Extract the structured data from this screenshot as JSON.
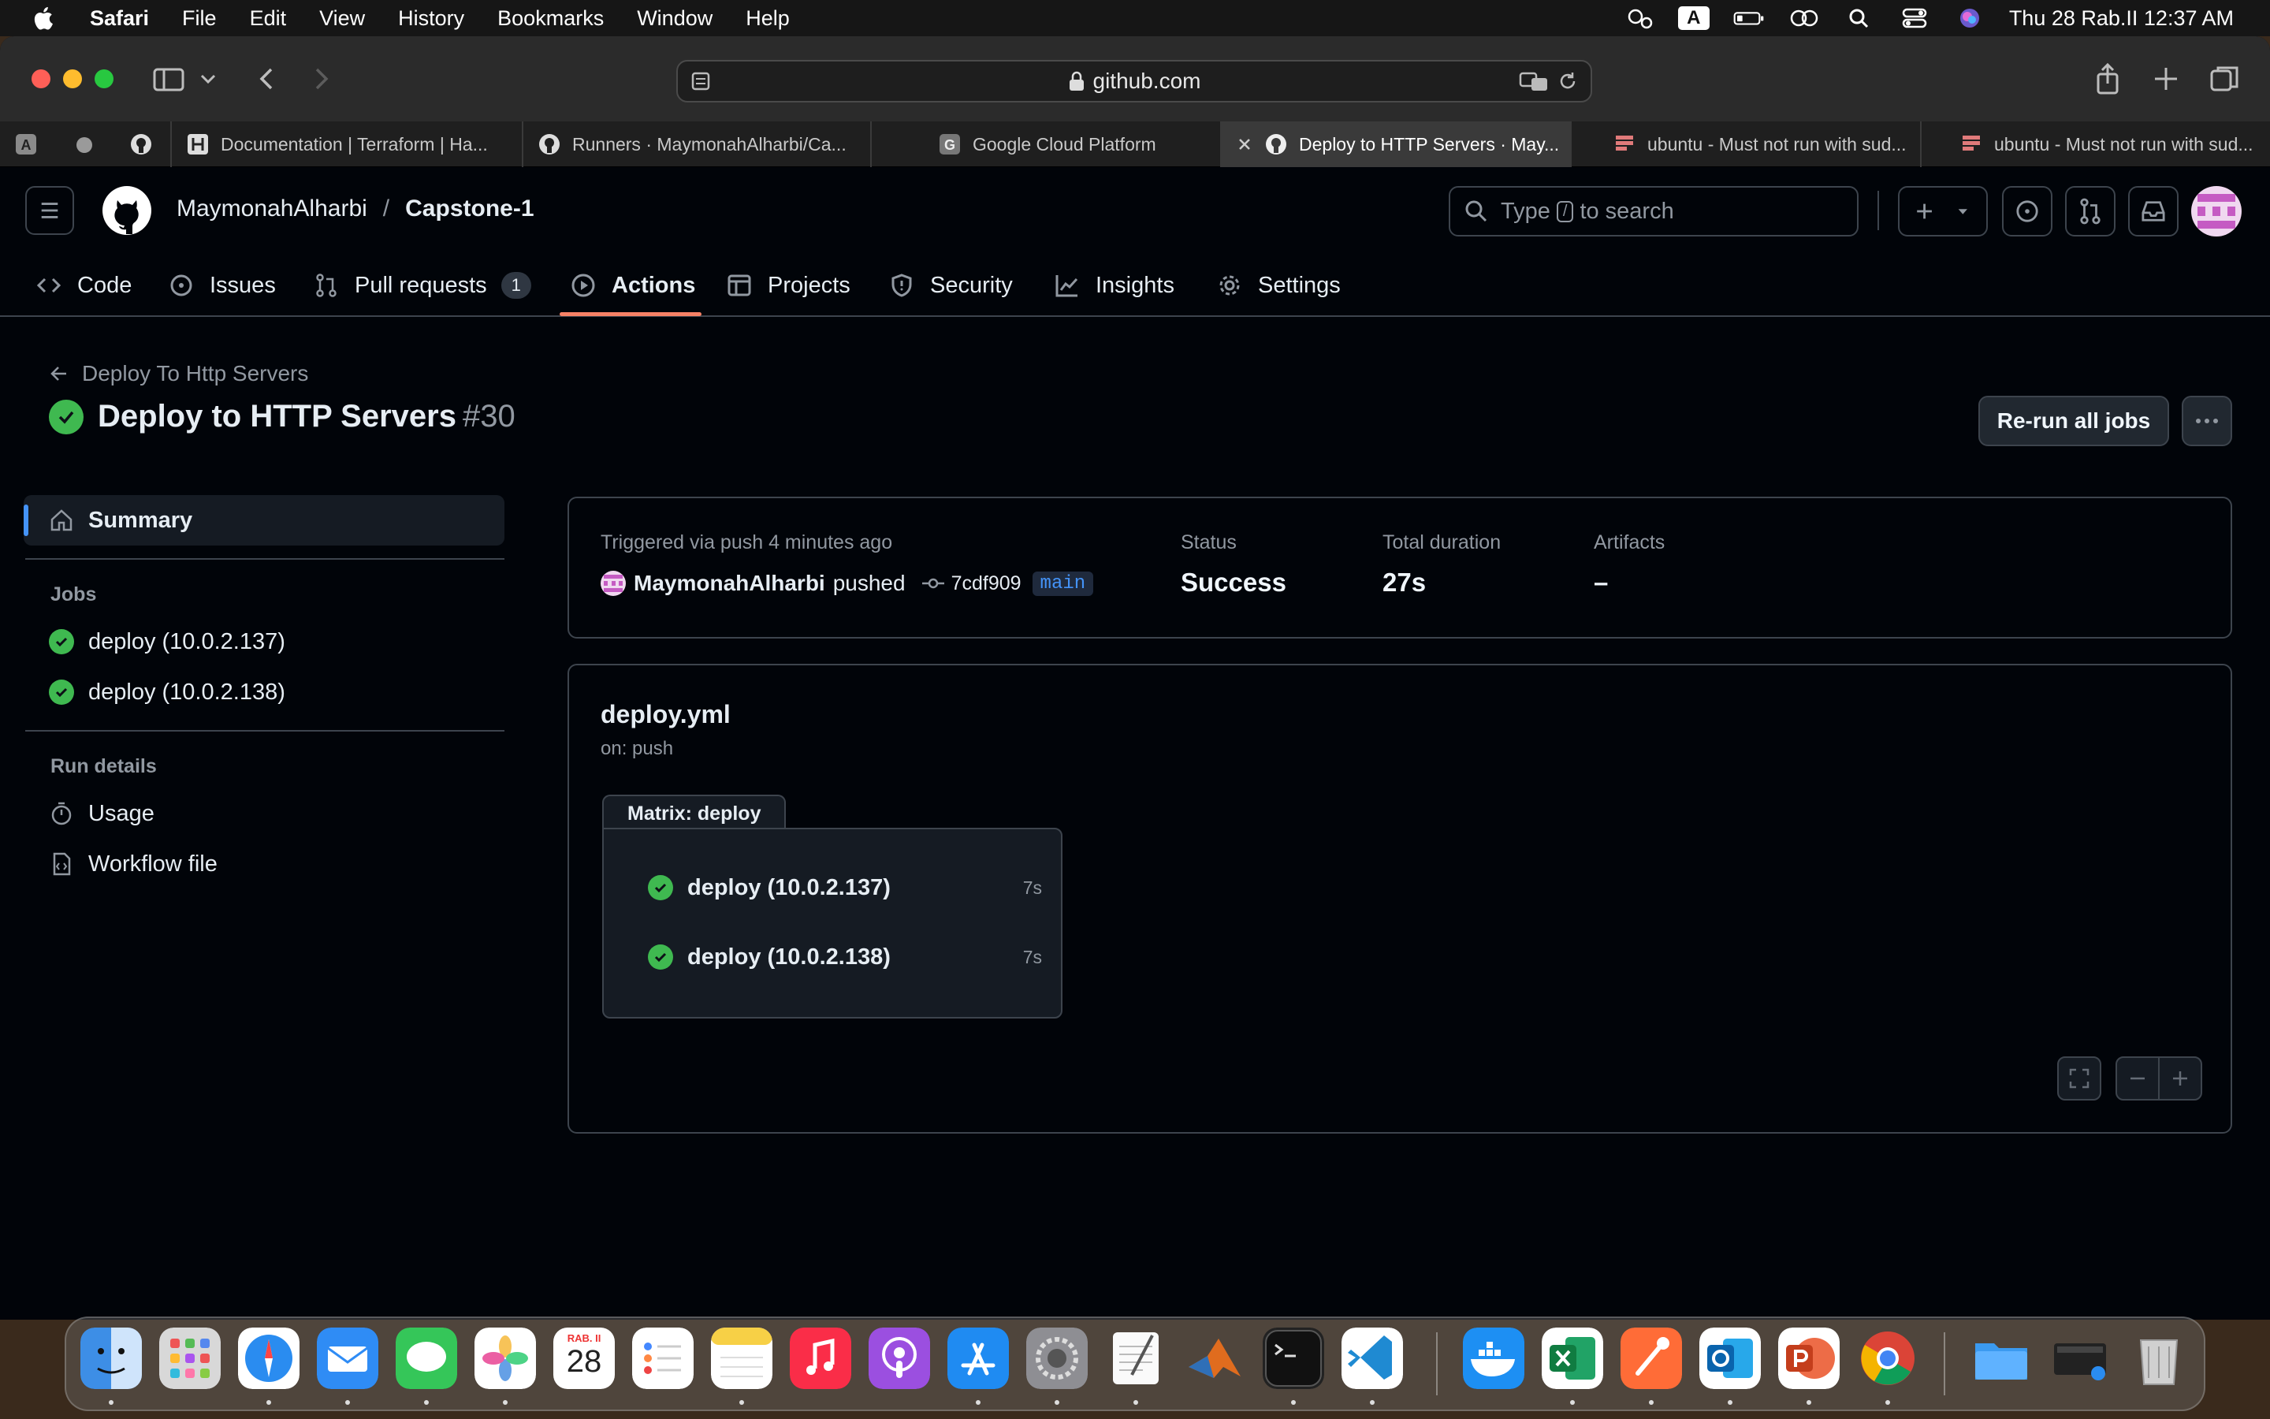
{
  "menubar": {
    "app": "Safari",
    "items": [
      "File",
      "Edit",
      "View",
      "History",
      "Bookmarks",
      "Window",
      "Help"
    ],
    "input_source": "A",
    "datetime": "Thu 28 Rab.II  12:37 AM"
  },
  "browser": {
    "address": "github.com",
    "tabs": [
      {
        "title": "Documentation | Terraform | Ha..."
      },
      {
        "title": "Runners · MaymonahAlharbi/Ca..."
      },
      {
        "title": "Google Cloud Platform"
      },
      {
        "title": "Deploy to HTTP Servers · May...",
        "active": true
      },
      {
        "title": "ubuntu - Must not run with sud..."
      },
      {
        "title": "ubuntu - Must not run with sud..."
      }
    ]
  },
  "github": {
    "owner": "MaymonahAlharbi",
    "separator": "/",
    "repo": "Capstone-1",
    "search_placeholder_pre": "Type",
    "search_key": "/",
    "search_placeholder_post": "to search",
    "nav": {
      "code": "Code",
      "issues": "Issues",
      "pulls": "Pull requests",
      "pulls_count": "1",
      "actions": "Actions",
      "projects": "Projects",
      "security": "Security",
      "insights": "Insights",
      "settings": "Settings"
    }
  },
  "run": {
    "back_label": "Deploy To Http Servers",
    "title": "Deploy to HTTP Servers",
    "number": "#30",
    "rerun_label": "Re-run all jobs"
  },
  "sidebar": {
    "summary": "Summary",
    "jobs_heading": "Jobs",
    "jobs": [
      "deploy (10.0.2.137)",
      "deploy (10.0.2.138)"
    ],
    "details_heading": "Run details",
    "usage": "Usage",
    "workflow_file": "Workflow file"
  },
  "summary": {
    "trigger": "Triggered via push 4 minutes ago",
    "actor": "MaymonahAlharbi",
    "action": "pushed",
    "commit": "7cdf909",
    "branch": "main",
    "status_label": "Status",
    "status_value": "Success",
    "duration_label": "Total duration",
    "duration_value": "27s",
    "artifacts_label": "Artifacts",
    "artifacts_value": "–"
  },
  "graph": {
    "workflow": "deploy.yml",
    "trigger": "on: push",
    "matrix_label": "Matrix: deploy",
    "jobs": [
      {
        "name": "deploy (10.0.2.137)",
        "duration": "7s"
      },
      {
        "name": "deploy (10.0.2.138)",
        "duration": "7s"
      }
    ]
  },
  "dock": {
    "calendar_month": "RAB. II",
    "calendar_day": "28"
  },
  "colors": {
    "success": "#3fb950",
    "accent": "#4493f8",
    "underline": "#f78166"
  }
}
